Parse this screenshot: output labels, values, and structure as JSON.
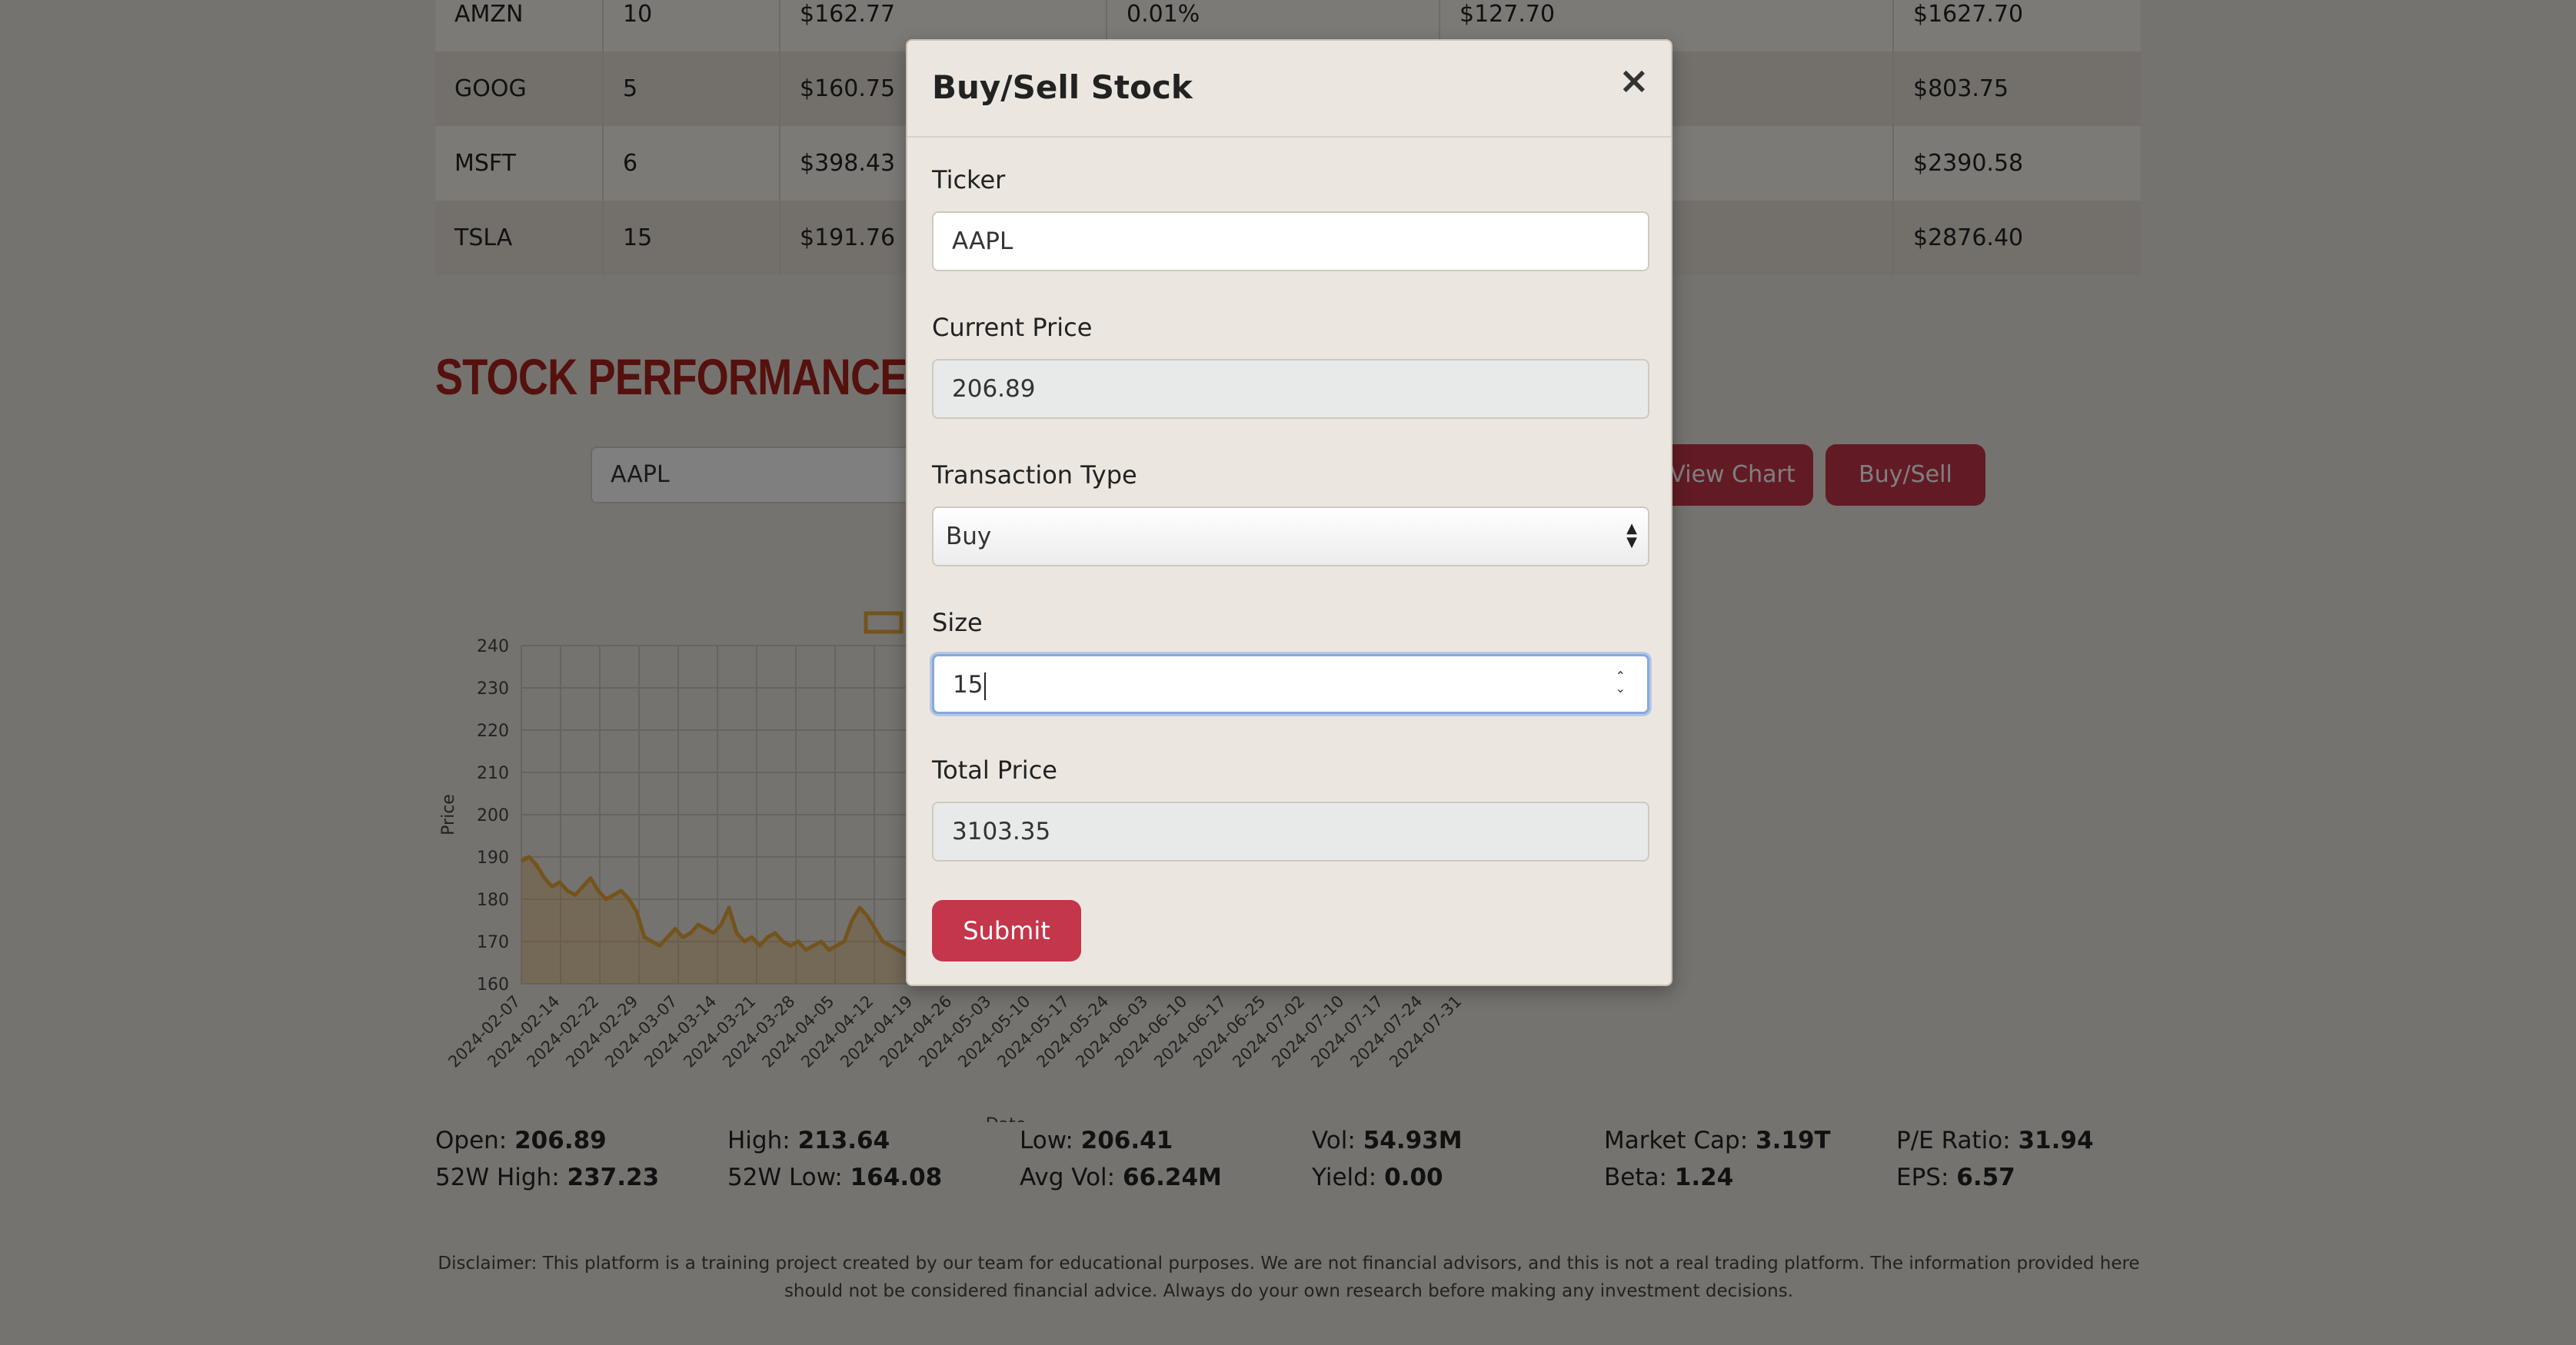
{
  "holdings": [
    {
      "ticker": "AMZN",
      "shares": "10",
      "price": "$162.77",
      "change": "0.01%",
      "cost": "$127.70",
      "value": "$1627.70"
    },
    {
      "ticker": "GOOG",
      "shares": "5",
      "price": "$160.75",
      "change": "",
      "cost": "",
      "value": "$803.75"
    },
    {
      "ticker": "MSFT",
      "shares": "6",
      "price": "$398.43",
      "change": "",
      "cost": "",
      "value": "$2390.58"
    },
    {
      "ticker": "TSLA",
      "shares": "15",
      "price": "$191.76",
      "change": "",
      "cost": "",
      "value": "$2876.40"
    }
  ],
  "performance": {
    "section_title": "Stock Performance Chart",
    "search_value": "AAPL",
    "view_chart_label": "View Chart",
    "buy_sell_label": "Buy/Sell"
  },
  "chart_data": {
    "type": "line",
    "xlabel": "Date",
    "ylabel": "Price",
    "ylim": [
      160,
      240
    ],
    "yticks": [
      160,
      170,
      180,
      190,
      200,
      210,
      220,
      230,
      240
    ],
    "x_ticks": [
      "2024-02-07",
      "2024-02-14",
      "2024-02-22",
      "2024-02-29",
      "2024-03-07",
      "2024-03-14",
      "2024-03-21",
      "2024-03-28",
      "2024-04-05",
      "2024-04-12",
      "2024-04-19",
      "2024-04-26",
      "2024-05-03",
      "2024-05-10",
      "2024-05-17",
      "2024-05-24",
      "2024-06-03",
      "2024-06-10",
      "2024-06-17",
      "2024-06-25",
      "2024-07-02",
      "2024-07-10",
      "2024-07-17",
      "2024-07-24",
      "2024-07-31"
    ],
    "series": [
      {
        "color": "#e9a93a",
        "values": [
          189,
          190,
          188,
          185,
          183,
          184,
          182,
          181,
          183,
          185,
          182,
          180,
          181,
          182,
          180,
          177,
          171,
          170,
          169,
          171,
          173,
          171,
          172,
          174,
          173,
          172,
          174,
          178,
          172,
          170,
          171,
          169,
          171,
          172,
          170,
          169,
          170,
          168,
          169,
          170,
          168,
          169,
          170,
          175,
          178,
          176,
          173,
          170,
          169,
          168,
          167,
          168
        ]
      }
    ]
  },
  "stats": {
    "open_label": "Open:",
    "open": "206.89",
    "high_label": "High:",
    "high": "213.64",
    "low_label": "Low:",
    "low": "206.41",
    "vol_label": "Vol:",
    "vol": "54.93M",
    "mcap_label": "Market Cap:",
    "mcap": "3.19T",
    "pe_label": "P/E Ratio:",
    "pe": "31.94",
    "w52h_label": "52W High:",
    "w52h": "237.23",
    "w52l_label": "52W Low:",
    "w52l": "164.08",
    "avgvol_label": "Avg Vol:",
    "avgvol": "66.24M",
    "yield_label": "Yield:",
    "yield": "0.00",
    "beta_label": "Beta:",
    "beta": "1.24",
    "eps_label": "EPS:",
    "eps": "6.57"
  },
  "disclaimer": "Disclaimer: This platform is a training project created by our team for educational purposes. We are not financial advisors, and this is not a real trading platform. The information provided here should not be considered financial advice. Always do your own research before making any investment decisions.",
  "modal": {
    "title": "Buy/Sell Stock",
    "close_symbol": "×",
    "ticker_label": "Ticker",
    "ticker_value": "AAPL",
    "price_label": "Current Price",
    "price_value": "206.89",
    "type_label": "Transaction Type",
    "type_value": "Buy",
    "size_label": "Size",
    "size_value": "15",
    "total_label": "Total Price",
    "total_value": "3103.35",
    "submit_label": "Submit"
  }
}
